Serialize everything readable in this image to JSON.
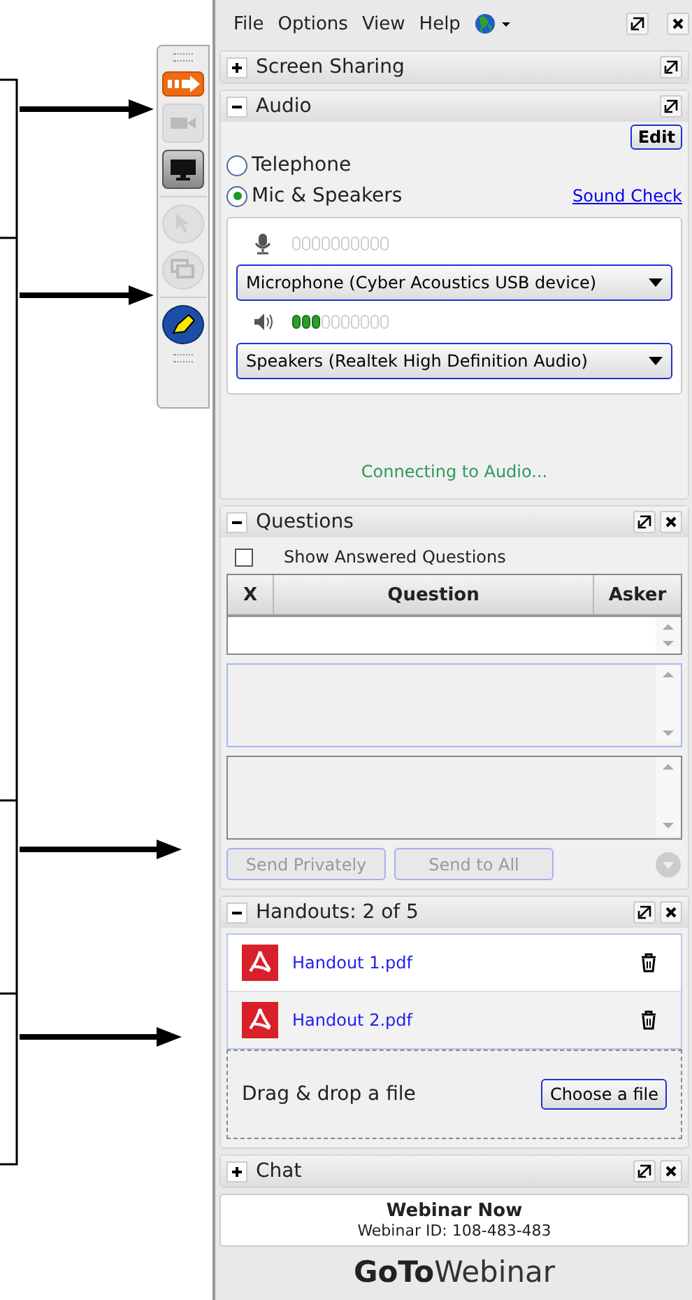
{
  "toolbar": [
    {
      "kind": "share",
      "disabled": false
    },
    {
      "kind": "webcam",
      "disabled": true
    },
    {
      "kind": "screen",
      "disabled": false
    },
    {
      "kind": "pointer",
      "disabled": true
    },
    {
      "kind": "drawing",
      "disabled": true
    },
    {
      "kind": "highlighter",
      "disabled": false
    }
  ],
  "menu": [
    "File",
    "Options",
    "View",
    "Help"
  ],
  "screen_sharing": {
    "title": "Screen Sharing",
    "expanded": false
  },
  "audio": {
    "title": "Audio",
    "expanded": true,
    "edit_button": "Edit",
    "options": [
      {
        "label": "Telephone",
        "selected": false
      },
      {
        "label": "Mic & Speakers",
        "selected": true
      }
    ],
    "sound_check": "Sound Check",
    "microphone": {
      "device": "Microphone (Cyber Acoustics USB device)"
    },
    "speakers": {
      "level": 0.3,
      "device": "Speakers (Realtek High Definition Audio)"
    },
    "status": "Connecting to Audio..."
  },
  "questions": {
    "title": "Questions",
    "expanded": true,
    "show_answered": {
      "label": "Show Answered Questions",
      "checked": false
    },
    "columns": [
      "X",
      "Question",
      "Asker"
    ],
    "buttons": [
      {
        "label": "Send Privately",
        "disabled": true
      },
      {
        "label": "Send to All",
        "disabled": true
      }
    ]
  },
  "handouts": {
    "title": "Handouts: 2 of 5",
    "expanded": true,
    "files": [
      {
        "name": "Handout 1.pdf"
      },
      {
        "name": "Handout 2.pdf"
      }
    ],
    "drop_hint": "Drag & drop a file",
    "choose_button": "Choose a file"
  },
  "chat": {
    "title": "Chat",
    "expanded": false
  },
  "webinar": {
    "title": "Webinar Now",
    "id": "Webinar ID: 108-483-483"
  },
  "logo": {
    "bold": "GoTo",
    "light": "Webinar"
  }
}
